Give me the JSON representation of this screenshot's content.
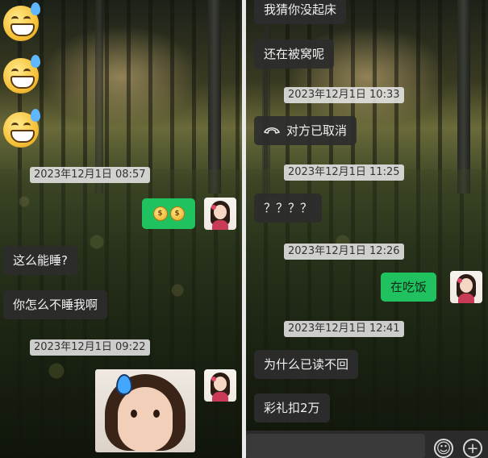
{
  "left": {
    "emojis": [
      "grinning-sweat-emoji",
      "grinning-sweat-emoji",
      "grinning-sweat-emoji"
    ],
    "timestamps": [
      "2023年12月1日 08:57",
      "2023年12月1日 09:22"
    ],
    "messages": [
      {
        "text": "这么能睡?"
      },
      {
        "text": "你怎么不睡我啊"
      }
    ],
    "sent_sticker": "coin-sticker",
    "photo": "crying-child-photo"
  },
  "right": {
    "messages_top": [
      "我猜你没起床",
      "还在被窝呢"
    ],
    "timestamps": [
      "2023年12月1日 10:33",
      "2023年12月1日 11:25",
      "2023年12月1日 12:26",
      "2023年12月1日 12:41"
    ],
    "call_status": "对方已取消",
    "question": "？？？？",
    "sent": "在吃饭",
    "messages_bottom": [
      "为什么已读不回",
      "彩礼扣2万"
    ]
  },
  "colors": {
    "bubble_dark": "#2d2d2d",
    "bubble_green": "#1fc25f",
    "timestamp_bg": "#e6e6e6"
  }
}
